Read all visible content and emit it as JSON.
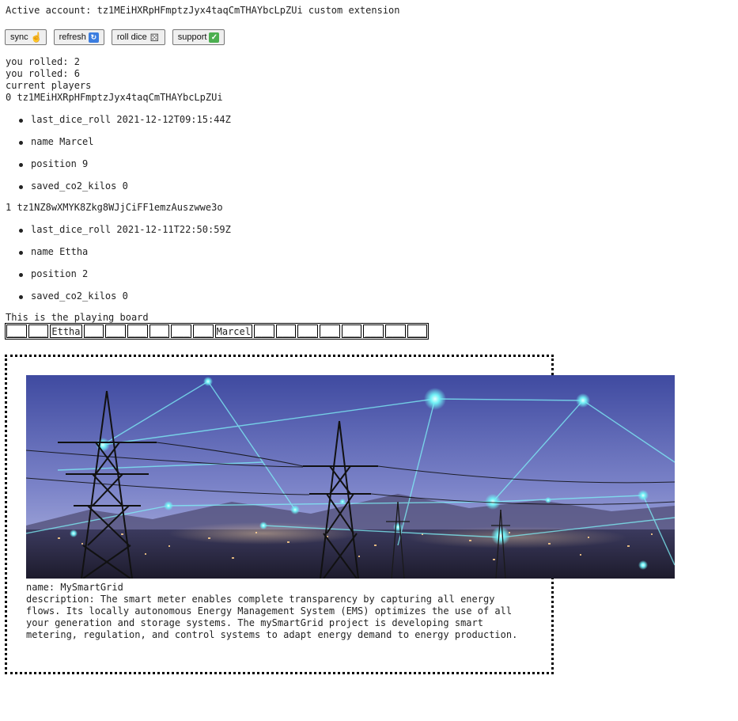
{
  "header": {
    "active_account_label": "Active account: ",
    "account_id": "tz1MEiHXRpHFmptzJyx4taqCmTHAYbcLpZUi",
    "account_suffix": " custom extension"
  },
  "buttons": {
    "sync": {
      "label": "sync",
      "icon": "pointing-hand-icon"
    },
    "refresh": {
      "label": "refresh",
      "icon": "refresh-icon"
    },
    "roll_dice": {
      "label": "roll dice",
      "icon": "dice-icon"
    },
    "support": {
      "label": "support",
      "icon": "check-mark-icon"
    }
  },
  "log": {
    "lines": [
      "you rolled: 2",
      "you rolled: 6",
      "current players"
    ]
  },
  "players": [
    {
      "index": "0",
      "address": "tz1MEiHXRpHFmptzJyx4taqCmTHAYbcLpZUi",
      "attributes": [
        {
          "key": "last_dice_roll",
          "value": "2021-12-12T09:15:44Z"
        },
        {
          "key": "name",
          "value": "Marcel"
        },
        {
          "key": "position",
          "value": "9"
        },
        {
          "key": "saved_co2_kilos",
          "value": "0"
        }
      ]
    },
    {
      "index": "1",
      "address": "tz1NZ8wXMYK8Zkg8WJjCiFF1emzAuszwwe3o",
      "attributes": [
        {
          "key": "last_dice_roll",
          "value": "2021-12-11T22:50:59Z"
        },
        {
          "key": "name",
          "value": "Ettha"
        },
        {
          "key": "position",
          "value": "2"
        },
        {
          "key": "saved_co2_kilos",
          "value": "0"
        }
      ]
    }
  ],
  "board": {
    "label": "This is the playing board",
    "cells": [
      "___",
      "___",
      "Ettha",
      "___",
      "___",
      "___",
      "___",
      "___",
      "___",
      "Marcel",
      "___",
      "___",
      "___",
      "___",
      "___",
      "___",
      "___",
      "___"
    ]
  },
  "card": {
    "name_label": "name: ",
    "name": "MySmartGrid",
    "description_label": "description: ",
    "description": "The smart meter enables complete transparency by capturing all energy flows. Its locally autonomous Energy Management System (EMS) optimizes the use of all your generation and storage systems. The mySmartGrid project is developing smart metering, regulation, and control systems to adapt energy demand to energy production.",
    "image": "smart-grid-power-lines-image"
  },
  "colors": {
    "sky_top": "#4b57a6",
    "sky_bottom": "#8a93cf",
    "glow": "#5fe6f0",
    "city": "#2e2c4a"
  }
}
